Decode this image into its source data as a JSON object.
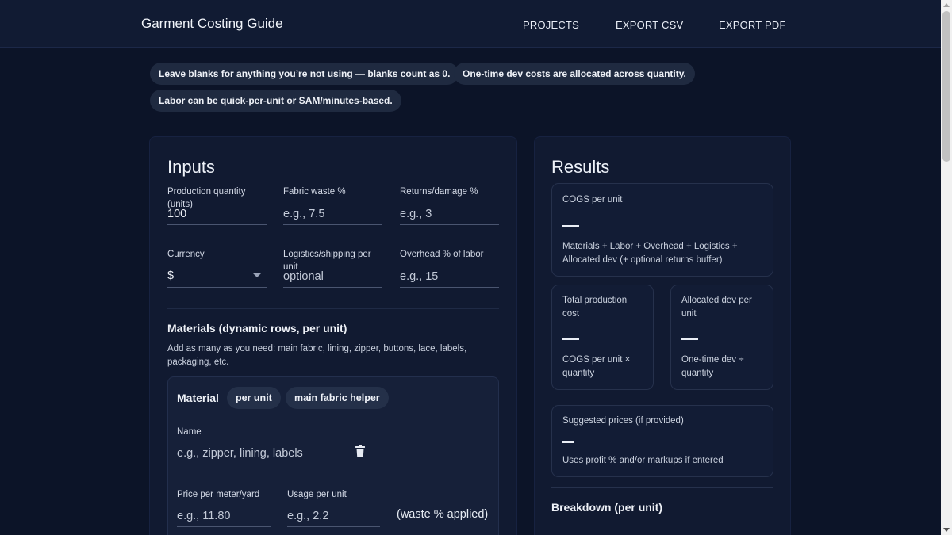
{
  "header": {
    "title": "Garment Costing Guide",
    "nav": [
      "PROJECTS",
      "EXPORT CSV",
      "EXPORT PDF"
    ]
  },
  "tips": [
    "Leave blanks for anything you’re not using — blanks count as 0.",
    "One-time dev costs are allocated across quantity.",
    "Labor can be quick-per-unit or SAM/minutes-based."
  ],
  "inputs": {
    "title": "Inputs",
    "quantity": {
      "label": "Production quantity (units)",
      "value": "100"
    },
    "fabric_waste": {
      "label": "Fabric waste %",
      "placeholder": "e.g., 7.5"
    },
    "returns": {
      "label": "Returns/damage %",
      "placeholder": "e.g., 3"
    },
    "currency": {
      "label": "Currency",
      "value": "$"
    },
    "logistics": {
      "label": "Logistics/shipping per unit",
      "placeholder": "optional"
    },
    "overhead": {
      "label": "Overhead % of labor",
      "placeholder": "e.g., 15"
    }
  },
  "materials": {
    "title": "Materials (dynamic rows, per unit)",
    "description": "Add as many as you need: main fabric, lining, zipper, buttons, lace, labels, packaging, etc.",
    "card": {
      "title": "Material",
      "pill_per_unit": "per unit",
      "pill_helper": "main fabric helper",
      "name_label": "Name",
      "name_placeholder": "e.g., zipper, lining, labels",
      "price_label": "Price per meter/yard",
      "price_placeholder": "e.g., 11.80",
      "usage_label": "Usage per unit",
      "usage_placeholder": "e.g., 2.2",
      "waste_note": "(waste % applied)"
    }
  },
  "results": {
    "title": "Results",
    "cogs": {
      "label": "COGS per unit",
      "value": "—",
      "note": "Materials + Labor + Overhead + Logistics + Allocated dev (+ optional returns buffer)"
    },
    "total": {
      "label": "Total production cost",
      "value": "—",
      "note": "COGS per unit × quantity"
    },
    "allocated": {
      "label": "Allocated dev per unit",
      "value": "—",
      "note": "One-time dev ÷ quantity"
    },
    "suggested": {
      "label": "Suggested prices (if provided)",
      "value": "—",
      "note": "Uses profit % and/or markups if entered"
    },
    "breakdown_title": "Breakdown (per unit)"
  }
}
